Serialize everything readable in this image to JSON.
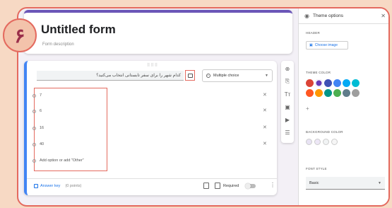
{
  "badge": {
    "number": "۶"
  },
  "form": {
    "title": "Untitled form",
    "description": "Form description"
  },
  "question": {
    "text": "کدام شهر را برای سفر تابستانی انتخاب می‌کنید؟",
    "type_label": "Multiple choice",
    "options": [
      "7",
      "6",
      "16",
      "40"
    ],
    "add_option_label": "Add option or add \"Other\"",
    "answer_key_label": "Answer key",
    "points_label": "(0 points)",
    "required_label": "Required"
  },
  "theme_panel": {
    "title": "Theme options",
    "header_section": "HEADER",
    "choose_image_label": "Choose image",
    "theme_color_section": "THEME COLOR",
    "theme_colors": [
      "#db4437",
      "#673ab7",
      "#3f51b5",
      "#4285f4",
      "#03a9f4",
      "#00bcd4",
      "#ff5722",
      "#ff9800",
      "#009688",
      "#4caf50",
      "#607d8b",
      "#9e9e9e"
    ],
    "background_color_section": "BACKGROUND COLOR",
    "background_colors": [
      "#e8e3f4",
      "#ede7f6",
      "#f1f3f4",
      "#f6f6f6"
    ],
    "font_style_section": "FONT STYLE",
    "font_style_value": "Basic"
  }
}
